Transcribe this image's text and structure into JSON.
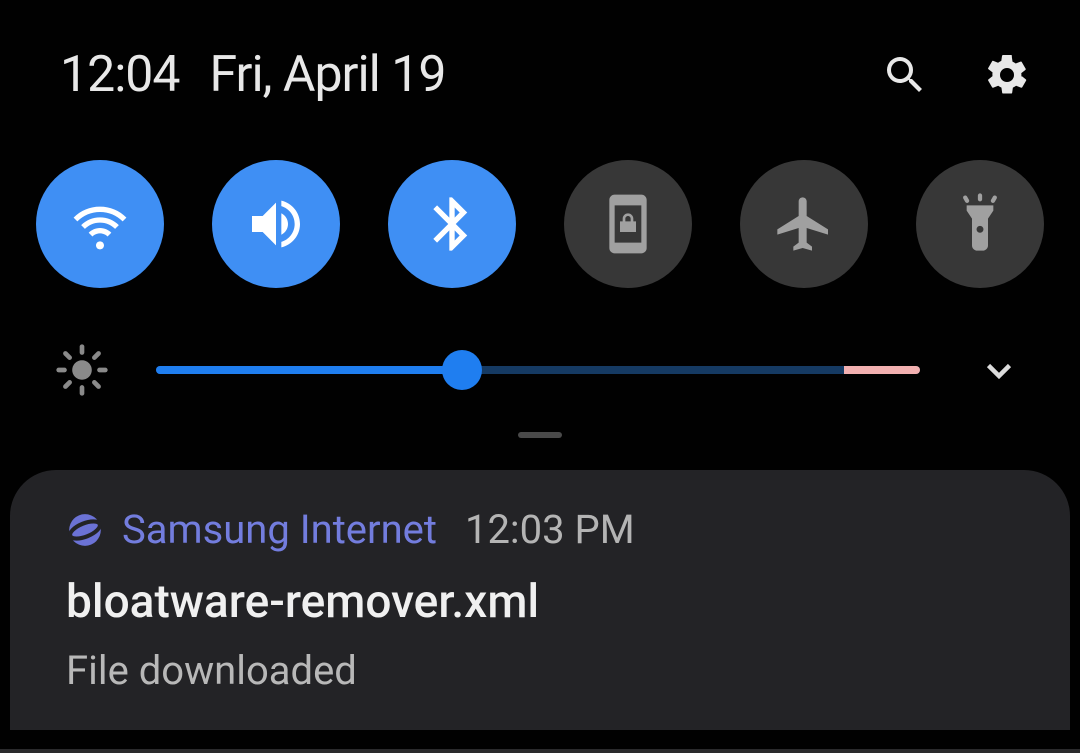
{
  "header": {
    "time": "12:04",
    "date": "Fri, April 19"
  },
  "toggles": [
    {
      "name": "wifi",
      "active": true
    },
    {
      "name": "sound",
      "active": true
    },
    {
      "name": "bluetooth",
      "active": true
    },
    {
      "name": "rotation-lock",
      "active": false
    },
    {
      "name": "airplane-mode",
      "active": false
    },
    {
      "name": "flashlight",
      "active": false
    }
  ],
  "brightness": {
    "value_percent": 40,
    "warn_zone_percent": 10
  },
  "notification": {
    "app_name": "Samsung Internet",
    "time": "12:03 PM",
    "title": "bloatware-remover.xml",
    "body": "File downloaded"
  }
}
